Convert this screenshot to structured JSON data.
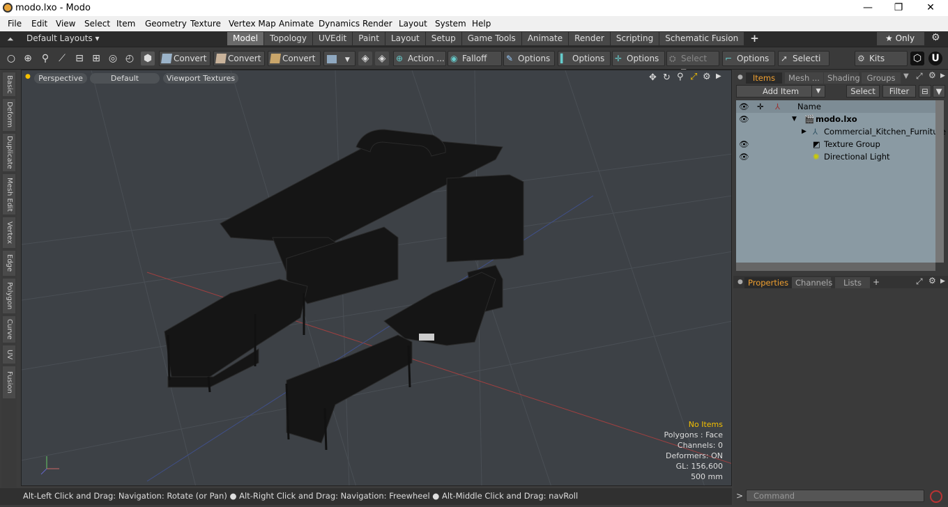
{
  "window": {
    "title": "modo.lxo - Modo",
    "min_icon": "—",
    "max_icon": "❐",
    "close_icon": "✕"
  },
  "menu": [
    "File",
    "Edit",
    "View",
    "Select",
    "Item",
    "Geometry",
    "Texture",
    "Vertex Map",
    "Animate",
    "Dynamics",
    "Render",
    "Layout",
    "System",
    "Help"
  ],
  "layout": {
    "label": "Default Layouts ▾",
    "only_label": "★  Only",
    "tabs": [
      "Model",
      "Topology",
      "UVEdit",
      "Paint",
      "Layout",
      "Setup",
      "Game Tools",
      "Animate",
      "Render",
      "Scripting",
      "Schematic Fusion"
    ],
    "add_tab": "+",
    "gear_icon": "⚙"
  },
  "toolbar": {
    "convert1": "Convert",
    "convert2": "Convert",
    "convert3": "Convert",
    "action": "Action  ...",
    "falloff": "Falloff",
    "options1": "Options",
    "options2": "Options",
    "options3": "Options",
    "select_t": "Select T...",
    "options4": "Options",
    "selecti": "Selecti ...",
    "kits": "Kits"
  },
  "left_tabs": [
    "Basic",
    "Deform",
    "Duplicate",
    "Mesh Edit",
    "Vertex",
    "Edge",
    "Polygon",
    "Curve",
    "UV",
    "Fusion"
  ],
  "viewport": {
    "perspective": "Perspective",
    "default": "Default",
    "textures": "Viewport Textures",
    "info": {
      "items": "No Items",
      "polygons": "Polygons : Face",
      "channels": "Channels: 0",
      "deformers": "Deformers: ON",
      "gl": "GL: 156,600",
      "scale": "500 mm"
    },
    "accent": "#f5c000"
  },
  "status": "Alt-Left Click and Drag: Navigation: Rotate (or Pan) ● Alt-Right Click and Drag: Navigation: Freewheel ● Alt-Middle Click and Drag: navRoll",
  "panel": {
    "tabs": [
      "Items",
      "Mesh ...",
      "Shading",
      "Groups"
    ],
    "add_item": "Add Item",
    "select": "Select",
    "filter": "Filter",
    "name_header": "Name",
    "tree": [
      "modo.lxo",
      "Commercial_Kitchen_Furniture",
      "Texture Group",
      "Directional Light"
    ],
    "props_tabs": [
      "Properties",
      "Channels",
      "Lists"
    ],
    "props_add": "+"
  },
  "command": {
    "placeholder": "Command",
    "prompt": ">"
  }
}
